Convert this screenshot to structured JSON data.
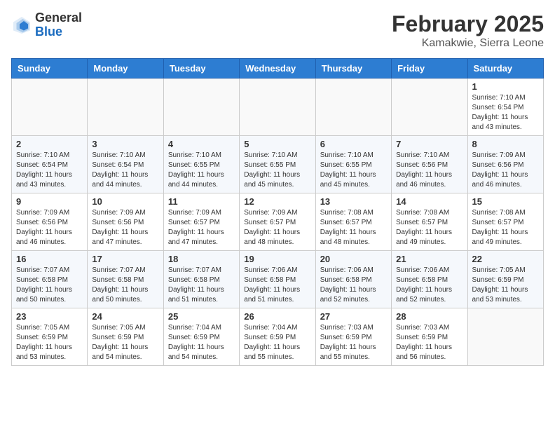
{
  "header": {
    "logo_general": "General",
    "logo_blue": "Blue",
    "month_title": "February 2025",
    "location": "Kamakwie, Sierra Leone"
  },
  "weekdays": [
    "Sunday",
    "Monday",
    "Tuesday",
    "Wednesday",
    "Thursday",
    "Friday",
    "Saturday"
  ],
  "weeks": [
    [
      {
        "day": "",
        "sunrise": "",
        "sunset": "",
        "daylight": ""
      },
      {
        "day": "",
        "sunrise": "",
        "sunset": "",
        "daylight": ""
      },
      {
        "day": "",
        "sunrise": "",
        "sunset": "",
        "daylight": ""
      },
      {
        "day": "",
        "sunrise": "",
        "sunset": "",
        "daylight": ""
      },
      {
        "day": "",
        "sunrise": "",
        "sunset": "",
        "daylight": ""
      },
      {
        "day": "",
        "sunrise": "",
        "sunset": "",
        "daylight": ""
      },
      {
        "day": "1",
        "sunrise": "Sunrise: 7:10 AM",
        "sunset": "Sunset: 6:54 PM",
        "daylight": "Daylight: 11 hours and 43 minutes."
      }
    ],
    [
      {
        "day": "2",
        "sunrise": "Sunrise: 7:10 AM",
        "sunset": "Sunset: 6:54 PM",
        "daylight": "Daylight: 11 hours and 43 minutes."
      },
      {
        "day": "3",
        "sunrise": "Sunrise: 7:10 AM",
        "sunset": "Sunset: 6:54 PM",
        "daylight": "Daylight: 11 hours and 44 minutes."
      },
      {
        "day": "4",
        "sunrise": "Sunrise: 7:10 AM",
        "sunset": "Sunset: 6:55 PM",
        "daylight": "Daylight: 11 hours and 44 minutes."
      },
      {
        "day": "5",
        "sunrise": "Sunrise: 7:10 AM",
        "sunset": "Sunset: 6:55 PM",
        "daylight": "Daylight: 11 hours and 45 minutes."
      },
      {
        "day": "6",
        "sunrise": "Sunrise: 7:10 AM",
        "sunset": "Sunset: 6:55 PM",
        "daylight": "Daylight: 11 hours and 45 minutes."
      },
      {
        "day": "7",
        "sunrise": "Sunrise: 7:10 AM",
        "sunset": "Sunset: 6:56 PM",
        "daylight": "Daylight: 11 hours and 46 minutes."
      },
      {
        "day": "8",
        "sunrise": "Sunrise: 7:09 AM",
        "sunset": "Sunset: 6:56 PM",
        "daylight": "Daylight: 11 hours and 46 minutes."
      }
    ],
    [
      {
        "day": "9",
        "sunrise": "Sunrise: 7:09 AM",
        "sunset": "Sunset: 6:56 PM",
        "daylight": "Daylight: 11 hours and 46 minutes."
      },
      {
        "day": "10",
        "sunrise": "Sunrise: 7:09 AM",
        "sunset": "Sunset: 6:56 PM",
        "daylight": "Daylight: 11 hours and 47 minutes."
      },
      {
        "day": "11",
        "sunrise": "Sunrise: 7:09 AM",
        "sunset": "Sunset: 6:57 PM",
        "daylight": "Daylight: 11 hours and 47 minutes."
      },
      {
        "day": "12",
        "sunrise": "Sunrise: 7:09 AM",
        "sunset": "Sunset: 6:57 PM",
        "daylight": "Daylight: 11 hours and 48 minutes."
      },
      {
        "day": "13",
        "sunrise": "Sunrise: 7:08 AM",
        "sunset": "Sunset: 6:57 PM",
        "daylight": "Daylight: 11 hours and 48 minutes."
      },
      {
        "day": "14",
        "sunrise": "Sunrise: 7:08 AM",
        "sunset": "Sunset: 6:57 PM",
        "daylight": "Daylight: 11 hours and 49 minutes."
      },
      {
        "day": "15",
        "sunrise": "Sunrise: 7:08 AM",
        "sunset": "Sunset: 6:57 PM",
        "daylight": "Daylight: 11 hours and 49 minutes."
      }
    ],
    [
      {
        "day": "16",
        "sunrise": "Sunrise: 7:07 AM",
        "sunset": "Sunset: 6:58 PM",
        "daylight": "Daylight: 11 hours and 50 minutes."
      },
      {
        "day": "17",
        "sunrise": "Sunrise: 7:07 AM",
        "sunset": "Sunset: 6:58 PM",
        "daylight": "Daylight: 11 hours and 50 minutes."
      },
      {
        "day": "18",
        "sunrise": "Sunrise: 7:07 AM",
        "sunset": "Sunset: 6:58 PM",
        "daylight": "Daylight: 11 hours and 51 minutes."
      },
      {
        "day": "19",
        "sunrise": "Sunrise: 7:06 AM",
        "sunset": "Sunset: 6:58 PM",
        "daylight": "Daylight: 11 hours and 51 minutes."
      },
      {
        "day": "20",
        "sunrise": "Sunrise: 7:06 AM",
        "sunset": "Sunset: 6:58 PM",
        "daylight": "Daylight: 11 hours and 52 minutes."
      },
      {
        "day": "21",
        "sunrise": "Sunrise: 7:06 AM",
        "sunset": "Sunset: 6:58 PM",
        "daylight": "Daylight: 11 hours and 52 minutes."
      },
      {
        "day": "22",
        "sunrise": "Sunrise: 7:05 AM",
        "sunset": "Sunset: 6:59 PM",
        "daylight": "Daylight: 11 hours and 53 minutes."
      }
    ],
    [
      {
        "day": "23",
        "sunrise": "Sunrise: 7:05 AM",
        "sunset": "Sunset: 6:59 PM",
        "daylight": "Daylight: 11 hours and 53 minutes."
      },
      {
        "day": "24",
        "sunrise": "Sunrise: 7:05 AM",
        "sunset": "Sunset: 6:59 PM",
        "daylight": "Daylight: 11 hours and 54 minutes."
      },
      {
        "day": "25",
        "sunrise": "Sunrise: 7:04 AM",
        "sunset": "Sunset: 6:59 PM",
        "daylight": "Daylight: 11 hours and 54 minutes."
      },
      {
        "day": "26",
        "sunrise": "Sunrise: 7:04 AM",
        "sunset": "Sunset: 6:59 PM",
        "daylight": "Daylight: 11 hours and 55 minutes."
      },
      {
        "day": "27",
        "sunrise": "Sunrise: 7:03 AM",
        "sunset": "Sunset: 6:59 PM",
        "daylight": "Daylight: 11 hours and 55 minutes."
      },
      {
        "day": "28",
        "sunrise": "Sunrise: 7:03 AM",
        "sunset": "Sunset: 6:59 PM",
        "daylight": "Daylight: 11 hours and 56 minutes."
      },
      {
        "day": "",
        "sunrise": "",
        "sunset": "",
        "daylight": ""
      }
    ]
  ]
}
